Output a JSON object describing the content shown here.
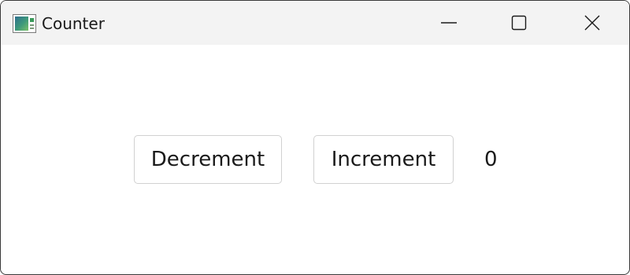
{
  "window": {
    "title": "Counter",
    "icon": "app-window-icon",
    "controls": {
      "minimize": "minimize-icon",
      "maximize": "maximize-icon",
      "close": "close-icon"
    }
  },
  "main": {
    "decrement_label": "Decrement",
    "increment_label": "Increment",
    "counter_value": "0"
  },
  "colors": {
    "titlebar_bg": "#f3f3f3",
    "window_bg": "#ffffff",
    "button_border": "#d1d1d1",
    "text": "#1a1a1a"
  }
}
